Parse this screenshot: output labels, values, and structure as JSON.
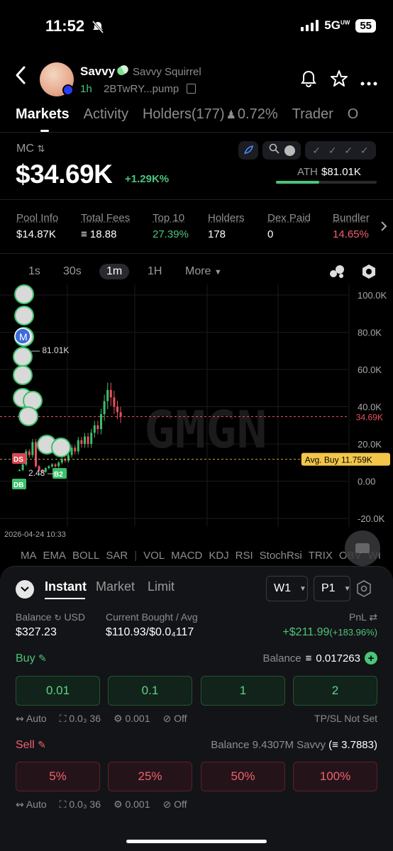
{
  "status_bar": {
    "time": "11:52",
    "network": "5G",
    "network_sup": "UW",
    "battery": "55"
  },
  "token": {
    "symbol": "Savvy",
    "full_name": "Savvy Squirrel",
    "age": "1h",
    "address": "2BTwRY...pump"
  },
  "tabs": [
    {
      "label": "Markets",
      "active": true
    },
    {
      "label": "Activity"
    },
    {
      "label": "Holders(177)"
    },
    {
      "label": "0.72%"
    },
    {
      "label": "Trader"
    },
    {
      "label": "O"
    }
  ],
  "market_cap": {
    "label": "MC",
    "value": "$34.69K",
    "change": "+1.29K%",
    "ath_label": "ATH",
    "ath_value": "$81.01K",
    "ath_progress": 0.43
  },
  "stats": [
    {
      "label": "Pool Info",
      "value": "$14.87K",
      "color": "#ffffff"
    },
    {
      "label": "Total Fees",
      "value": "18.88",
      "color": "#ffffff"
    },
    {
      "label": "Top 10",
      "value": "27.39%",
      "color": "#4ac57a"
    },
    {
      "label": "Holders",
      "value": "178",
      "color": "#ffffff"
    },
    {
      "label": "Dex Paid",
      "value": "0",
      "color": "#ffffff"
    },
    {
      "label": "Bundler",
      "value": "14.65%",
      "color": "#f0606d"
    }
  ],
  "timeframes": [
    "1s",
    "30s",
    "1m",
    "1H",
    "More"
  ],
  "active_timeframe": "1m",
  "chart": {
    "watermark": "GMGN",
    "y_ticks": [
      "100.0K",
      "80.0K",
      "60.0K",
      "40.0K",
      "20.0K",
      "0.00",
      "-20.0K"
    ],
    "current_price_label": "34.69K",
    "avg_buy_label": "Avg. Buy 11.759K",
    "ath_marker": "81.01K",
    "low_marker": "2.48",
    "date_label": "2026-04-24 10:33",
    "trade_markers": [
      "DS",
      "DB",
      "B2",
      "M"
    ]
  },
  "chart_data": {
    "type": "candlestick",
    "ylim": [
      -20000,
      100000
    ],
    "y_ticks": [
      100000,
      80000,
      60000,
      40000,
      20000,
      0,
      -20000
    ],
    "current_price": 34690,
    "avg_buy": 11759,
    "candles_close": [
      6000,
      9000,
      16000,
      14000,
      21000,
      8000,
      6000,
      5000,
      7000,
      8000,
      9000,
      8000,
      10000,
      12000,
      11000,
      14000,
      18000,
      16000,
      22000,
      20000,
      24000,
      20000,
      26000,
      30000,
      28000,
      36000,
      43000,
      49000,
      45000,
      40000,
      37000,
      34690
    ]
  },
  "indicators": [
    "MA",
    "EMA",
    "BOLL",
    "SAR",
    "|",
    "VOL",
    "MACD",
    "KDJ",
    "RSI",
    "StochRsi",
    "TRIX",
    "OBV",
    "WI"
  ],
  "trade": {
    "tabs": [
      "Instant",
      "Market",
      "Limit"
    ],
    "wallet": "W1",
    "preset": "P1",
    "balance_label": "Balance",
    "balance_unit": "USD",
    "balance_value": "$327.23",
    "bought_label": "Current Bought / Avg",
    "bought_value": "$110.93/$0.0₄117",
    "pnl_label": "PnL",
    "pnl_value": "+$211.99",
    "pnl_pct": "(+183.96%)",
    "buy_label": "Buy",
    "buy_balance_label": "Balance",
    "buy_balance_value": "0.017263",
    "buy_amounts": [
      "0.01",
      "0.1",
      "1",
      "2"
    ],
    "opt_auto": "Auto",
    "opt_gas": "0.0₃ 36",
    "opt_fee": "0.001",
    "opt_mev": "Off",
    "tpsl": "TP/SL Not Set",
    "sell_label": "Sell",
    "sell_balance": "Balance 9.4307M Savvy",
    "sell_balance_sol": "3.7883",
    "sell_pcts": [
      "5%",
      "25%",
      "50%",
      "100%"
    ]
  }
}
